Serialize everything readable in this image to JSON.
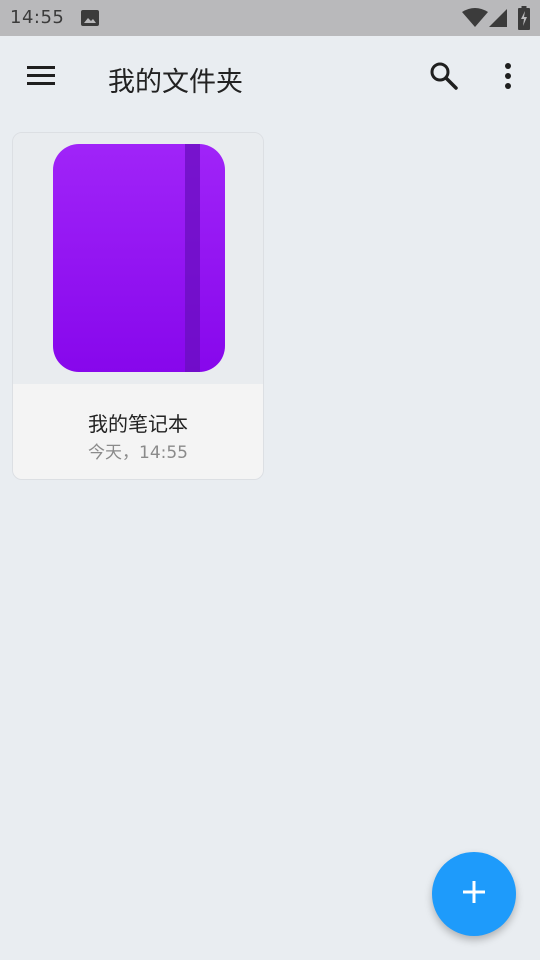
{
  "status_bar": {
    "time": "14:55",
    "icons": [
      "image-notification-icon",
      "wifi-icon",
      "cell-signal-icon",
      "battery-icon"
    ]
  },
  "app_bar": {
    "title": "我的文件夹",
    "menu_icon": "hamburger-menu-icon",
    "search_icon": "search-icon",
    "more_icon": "more-vertical-icon"
  },
  "notebooks": [
    {
      "title": "我的笔记本",
      "date": "今天，14:55",
      "cover_color": "#9a1ef5"
    }
  ],
  "fab": {
    "icon": "plus-icon",
    "color": "#1e9bfb"
  },
  "colors": {
    "background": "#e9edf1",
    "status_bar": "#b9b9bb",
    "accent": "#1e9bfb"
  }
}
